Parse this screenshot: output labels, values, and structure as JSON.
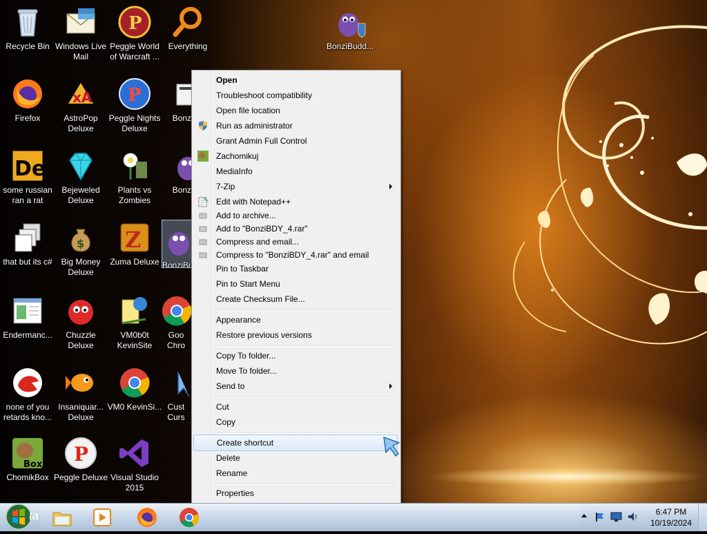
{
  "desktop": {
    "icons": [
      {
        "label": "Recycle Bin",
        "icon": "recycle-bin-icon"
      },
      {
        "label": "Windows Live Mail",
        "icon": "windows-live-mail-icon"
      },
      {
        "label": "Peggle World of Warcraft ...",
        "icon": "peggle-world-of-warcraft-icon"
      },
      {
        "label": "Everything",
        "icon": "magnifier-icon"
      },
      {
        "label": "BonziBudd...",
        "icon": "bonzibuddy-icon"
      },
      {
        "label": "Firefox",
        "icon": "firefox-icon"
      },
      {
        "label": "AstroPop Deluxe",
        "icon": "astropop-icon"
      },
      {
        "label": "Peggle Nights Deluxe",
        "icon": "peggle-nights-icon"
      },
      {
        "label": "BonziBu",
        "icon": "folder-icon"
      },
      {
        "label": "some russian ran a rat",
        "icon": "de-icon"
      },
      {
        "label": "Bejeweled Deluxe",
        "icon": "diamond-icon"
      },
      {
        "label": "Plants vs Zombies",
        "icon": "plants-vs-zombies-icon"
      },
      {
        "label": "BonziBu",
        "icon": "bonzibuddy-icon"
      },
      {
        "label": "that but its c#",
        "icon": "windows-stack-icon"
      },
      {
        "label": "Big Money Deluxe",
        "icon": "money-bag-icon"
      },
      {
        "label": "Zuma Deluxe",
        "icon": "zuma-icon"
      },
      {
        "label": "BonziBu",
        "icon": "bonzibuddy-icon"
      },
      {
        "label": "Endermanc...",
        "icon": "window-app-icon"
      },
      {
        "label": "Chuzzle Deluxe",
        "icon": "chuzzle-icon"
      },
      {
        "label": "VM0b0t KevinSite",
        "icon": "vmbot-icon"
      },
      {
        "label": "Goo Chro",
        "icon": "chrome-icon"
      },
      {
        "label": "none of you retards kno...",
        "icon": "red-bird-icon"
      },
      {
        "label": "Insaniquar... Deluxe",
        "icon": "goldfish-icon"
      },
      {
        "label": "VM0 KevinSi...",
        "icon": "chrome-icon"
      },
      {
        "label": "Cust Curs",
        "icon": "cursor-icon"
      },
      {
        "label": "ChomikBox",
        "icon": "chomikbox-icon"
      },
      {
        "label": "Peggle Deluxe",
        "icon": "peggle-icon"
      },
      {
        "label": "Visual Studio 2015",
        "icon": "visual-studio-icon"
      }
    ]
  },
  "context_menu": {
    "items": [
      {
        "label": "Open",
        "bold": true
      },
      {
        "label": "Troubleshoot compatibility"
      },
      {
        "label": "Open file location"
      },
      {
        "label": "Run as administrator",
        "icon": "uac-shield-icon"
      },
      {
        "label": "Grant Admin Full Control"
      },
      {
        "label": "Zachomikuj",
        "icon": "chomikuj-icon"
      },
      {
        "label": "MediaInfo"
      },
      {
        "label": "7-Zip",
        "submenu": true
      },
      {
        "label": "Edit with Notepad++",
        "icon": "notepad-plus-icon"
      },
      {
        "label": "Add to archive...",
        "icon": "archive-icon"
      },
      {
        "label": "Add to \"BonziBDY_4.rar\"",
        "icon": "archive-icon"
      },
      {
        "label": "Compress and email...",
        "icon": "archive-icon"
      },
      {
        "label": "Compress to \"BonziBDY_4.rar\" and email",
        "icon": "archive-icon"
      },
      {
        "label": "Pin to Taskbar"
      },
      {
        "label": "Pin to Start Menu"
      },
      {
        "label": "Create Checksum File..."
      },
      {
        "label": "Appearance"
      },
      {
        "label": "Restore previous versions"
      },
      {
        "label": "Copy To folder..."
      },
      {
        "label": "Move To folder..."
      },
      {
        "label": "Send to",
        "submenu": true
      },
      {
        "label": "Cut"
      },
      {
        "label": "Copy"
      },
      {
        "label": "Create shortcut",
        "hover": true
      },
      {
        "label": "Delete"
      },
      {
        "label": "Rename"
      },
      {
        "label": "Properties"
      }
    ]
  },
  "taskbar": {
    "start_label": "ta",
    "pinned": [
      {
        "name": "explorer",
        "icon": "folder-icon"
      },
      {
        "name": "media-player",
        "icon": "media-player-icon"
      },
      {
        "name": "firefox",
        "icon": "firefox-icon"
      },
      {
        "name": "chrome",
        "icon": "chrome-icon"
      }
    ],
    "clock_time": "6:47 PM",
    "clock_date": "10/19/2024"
  }
}
